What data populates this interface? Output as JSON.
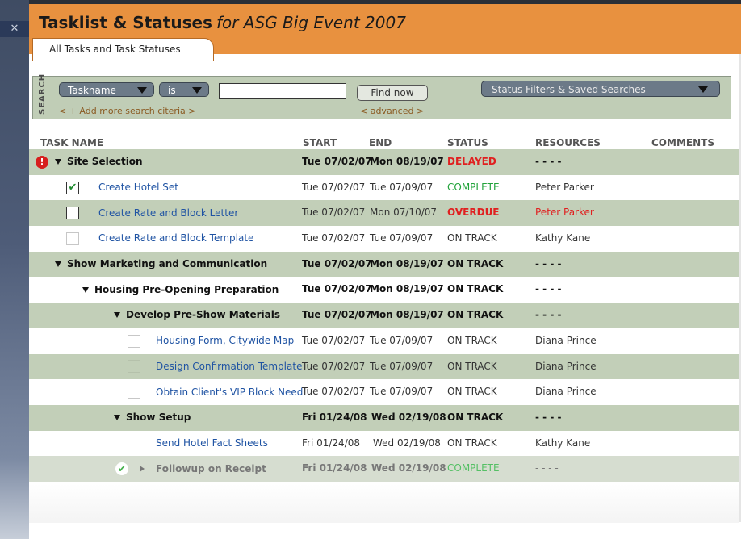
{
  "window": {
    "close_glyph": "✕"
  },
  "header": {
    "title_main": "Tasklist & Statuses",
    "title_sub": "for ASG Big Event 2007",
    "color": "#e8913f"
  },
  "tab": {
    "label": "All Tasks and Task Statuses"
  },
  "search": {
    "side_label": "SEARCH",
    "field_select": "Taskname",
    "operator_select": "is",
    "query_value": "",
    "find_button": "Find now",
    "add_more_link": "< + Add more search citeria >",
    "advanced_link": "< advanced >",
    "status_filter": "Status Filters & Saved Searches"
  },
  "columns": {
    "task": "TASK NAME",
    "start": "START",
    "end": "END",
    "status": "STATUS",
    "resources": "RESOURCES",
    "comments": "COMMENTS"
  },
  "rows": [
    {
      "name": "Site Selection",
      "start": "Tue 07/02/07",
      "end": "Mon 08/19/07",
      "status": "DELAYED",
      "resources": "- - - -"
    },
    {
      "name": "Create Hotel Set",
      "start": "Tue 07/02/07",
      "end": "Tue 07/09/07",
      "status": "COMPLETE",
      "resources": "Peter Parker"
    },
    {
      "name": "Create Rate and Block Letter",
      "start": "Tue 07/02/07",
      "end": "Mon 07/10/07",
      "status": "OVERDUE",
      "resources": "Peter Parker"
    },
    {
      "name": "Create Rate and Block Template",
      "start": "Tue 07/02/07",
      "end": "Tue 07/09/07",
      "status": "ON TRACK",
      "resources": "Kathy Kane"
    },
    {
      "name": "Show Marketing and Communication",
      "start": "Tue 07/02/07",
      "end": "Mon 08/19/07",
      "status": "ON TRACK",
      "resources": "- - - -"
    },
    {
      "name": "Housing Pre-Opening Preparation",
      "start": "Tue 07/02/07",
      "end": "Mon 08/19/07",
      "status": "ON TRACK",
      "resources": "- - - -"
    },
    {
      "name": "Develop Pre-Show Materials",
      "start": "Tue 07/02/07",
      "end": "Mon 08/19/07",
      "status": "ON TRACK",
      "resources": "- - - -"
    },
    {
      "name": "Housing Form, Citywide Map",
      "start": "Tue 07/02/07",
      "end": "Tue 07/09/07",
      "status": "ON TRACK",
      "resources": "Diana Prince"
    },
    {
      "name": "Design Confirmation Template",
      "start": "Tue 07/02/07",
      "end": "Tue 07/09/07",
      "status": "ON TRACK",
      "resources": "Diana Prince"
    },
    {
      "name": "Obtain Client's VIP Block Need",
      "start": "Tue 07/02/07",
      "end": "Tue 07/09/07",
      "status": "ON TRACK",
      "resources": "Diana Prince"
    },
    {
      "name": "Show Setup",
      "start": "Fri 01/24/08",
      "end": "Wed 02/19/08",
      "status": "ON TRACK",
      "resources": "- - - -"
    },
    {
      "name": "Send Hotel Fact Sheets",
      "start": "Fri 01/24/08",
      "end": "Wed 02/19/08",
      "status": "ON TRACK",
      "resources": "Kathy Kane"
    },
    {
      "name": "Followup on Receipt",
      "start": "Fri 01/24/08",
      "end": "Wed 02/19/08",
      "status": "COMPLETE",
      "resources": "- - - -"
    }
  ]
}
